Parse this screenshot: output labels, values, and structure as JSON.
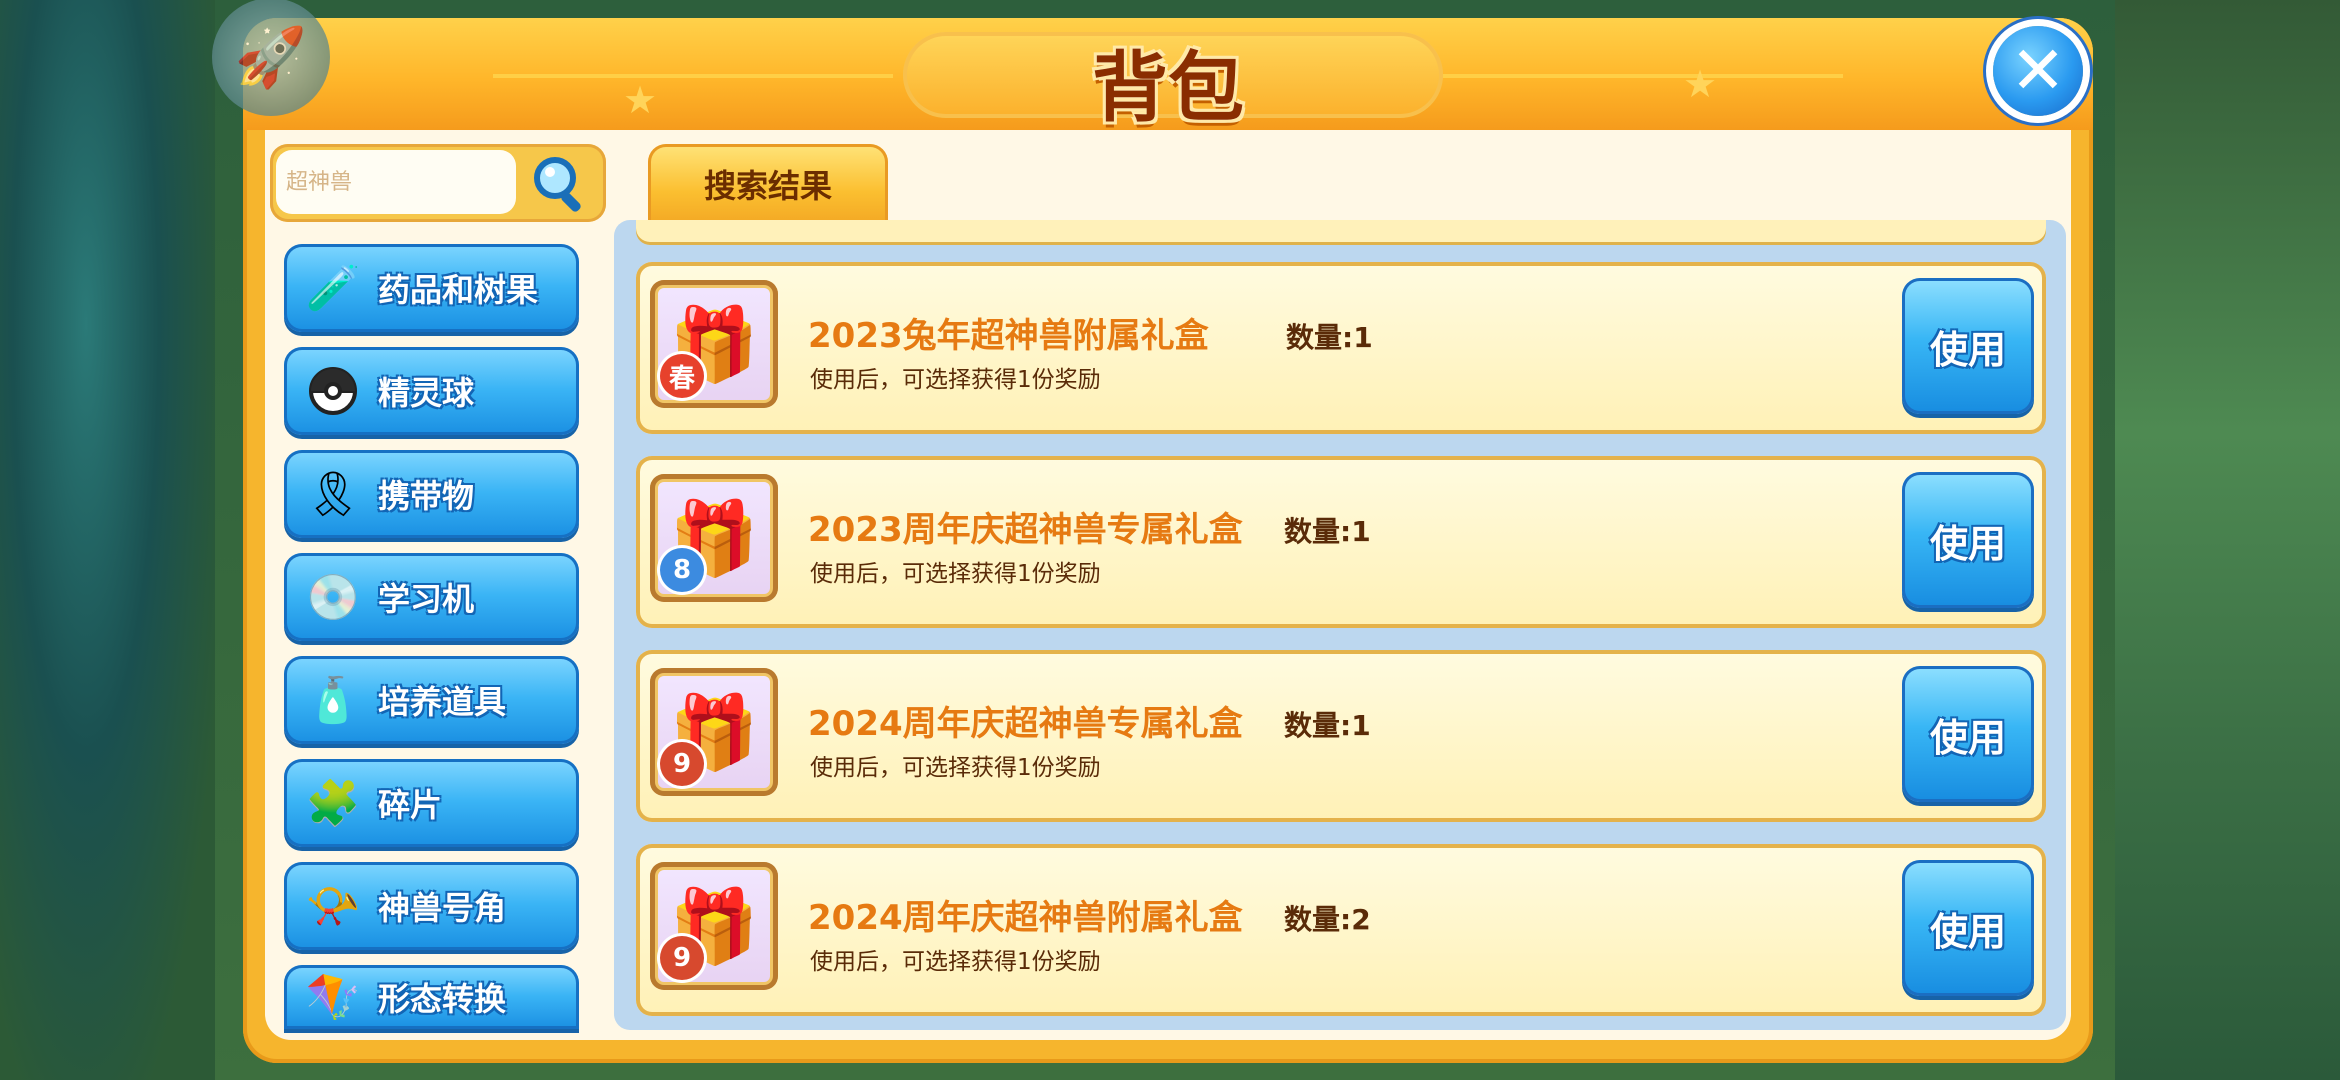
{
  "window": {
    "title": "背包",
    "close_icon": "close-icon"
  },
  "search": {
    "placeholder": "超神兽"
  },
  "sidebar": {
    "items": [
      {
        "label": "药品和树果",
        "icon": "potion-icon"
      },
      {
        "label": "精灵球",
        "icon": "pokeball-icon"
      },
      {
        "label": "携带物",
        "icon": "held-item-icon"
      },
      {
        "label": "学习机",
        "icon": "disc-icon"
      },
      {
        "label": "培养道具",
        "icon": "training-item-icon"
      },
      {
        "label": "碎片",
        "icon": "puzzle-piece-icon"
      },
      {
        "label": "神兽号角",
        "icon": "horn-icon"
      },
      {
        "label": "形态转换",
        "icon": "transform-icon"
      }
    ]
  },
  "tabs": [
    {
      "label": "搜索结果"
    }
  ],
  "items": [
    {
      "name": "2023兔年超神兽附属礼盒",
      "quantity": "数量:1",
      "desc": "使用后，可选择获得1份奖励",
      "use_label": "使用",
      "badge": "春"
    },
    {
      "name": "2023周年庆超神兽专属礼盒",
      "quantity": "数量:1",
      "desc": "使用后，可选择获得1份奖励",
      "use_label": "使用",
      "badge": "8"
    },
    {
      "name": "2024周年庆超神兽专属礼盒",
      "quantity": "数量:1",
      "desc": "使用后，可选择获得1份奖励",
      "use_label": "使用",
      "badge": "9"
    },
    {
      "name": "2024周年庆超神兽附属礼盒",
      "quantity": "数量:2",
      "desc": "使用后，可选择获得1份奖励",
      "use_label": "使用",
      "badge": "9"
    }
  ],
  "colors": {
    "accent": "#f6b52d",
    "button": "#2a9af0",
    "item_name": "#e67a12"
  }
}
